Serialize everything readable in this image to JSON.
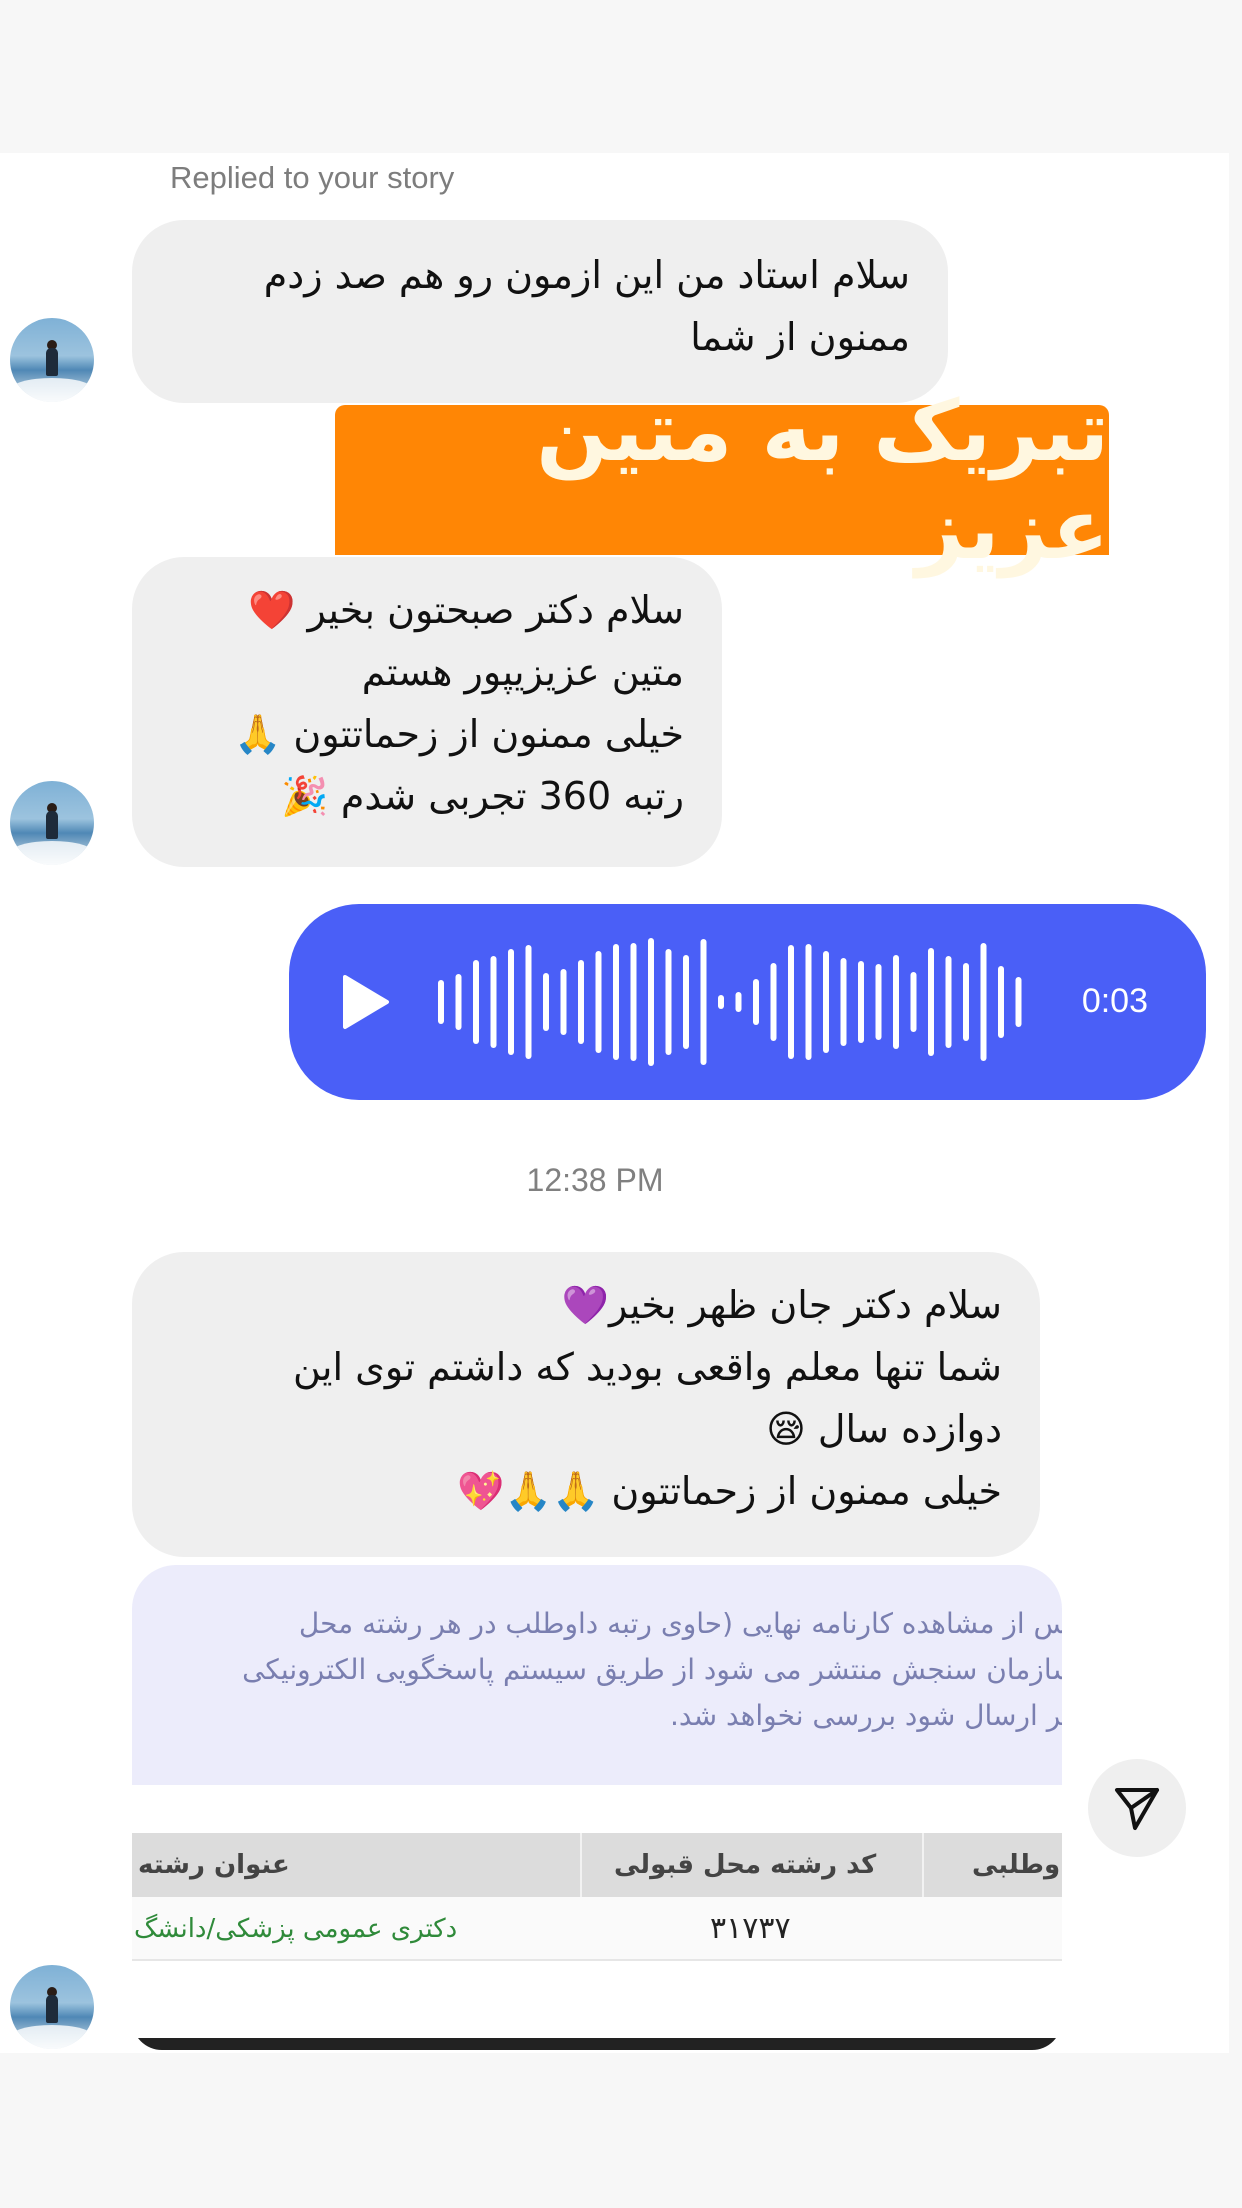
{
  "story_reply": {
    "label": "Replied to your story"
  },
  "messages": {
    "m1": {
      "lines": [
        "سلام  استاد من این ازمون رو  هم صد زدم",
        "ممنون از شما"
      ]
    },
    "banner": {
      "text": "تبریک به متین عزیز"
    },
    "m2": {
      "lines": [
        "سلام دکتر صبحتون بخیر ❤️",
        "متین عزیزیپور هستم",
        "خیلی ممنون از زحماتتون 🙏",
        "رتبه 360 تجربی شدم 🎉"
      ]
    },
    "voice": {
      "duration": "0:03",
      "icon": "play-icon"
    },
    "timestamp": "12:38 PM",
    "m3": {
      "lines": [
        "سلام دکتر جان ظهر بخیر💜",
        "شما تنها معلم واقعی بودید که داشتم  توی این",
        "دوازده سال 😪",
        "خیلی ممنون از زحماتتون 🙏🙏💖"
      ]
    },
    "photo": {
      "notice_lines": [
        "سوال پس از مشاهده کارنامه نهایی (حاوی رتبه داوطلب در هر رشته محل",
        "سایت سازمان سنجش منتشر می شود از طریق سیستم پاسخگویی الکترونیکی",
        "های دیگر ارسال شود بررسی نخواهد شد."
      ],
      "headers": {
        "field_title": "عنوان رشته",
        "field_code": "کد رشته محل قبولی",
        "applicant": "داوطلبی"
      },
      "row": {
        "field_title": "دکتری عمومی پزشکی/دانشگ",
        "field_code": "۳۱۷۳۷"
      }
    }
  },
  "actions": {
    "share_icon": "paper-plane-icon"
  },
  "colors": {
    "bubble_bg": "#efefef",
    "voice_bg": "#4a5ff7",
    "banner_bg": "#ff8605"
  }
}
